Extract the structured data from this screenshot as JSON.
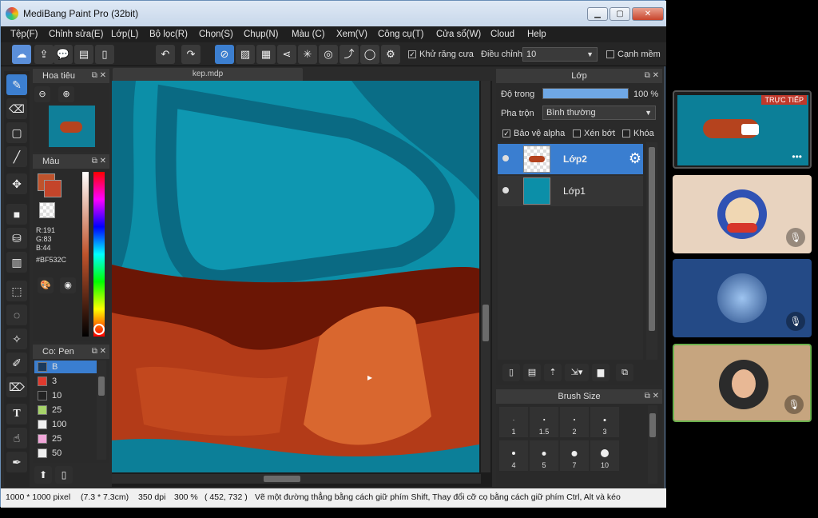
{
  "window": {
    "title": "MediBang Paint Pro (32bit)"
  },
  "menu": [
    "Tệp(F)",
    "Chỉnh sửa(E)",
    "Lớp(L)",
    "Bộ lọc(R)",
    "Chọn(S)",
    "Chụp(N)",
    "Màu (C)",
    "Xem(V)",
    "Công cụ(T)",
    "Cửa sổ(W)",
    "Cloud",
    "Help"
  ],
  "toolbar": {
    "antialias_label": "Khử răng cưa",
    "adjust_label": "Điều chỉnh",
    "adjust_value": "10",
    "edge_label": "Cạnh mềm"
  },
  "navigator": {
    "title": "Hoa tiêu"
  },
  "color_panel": {
    "title": "Màu",
    "r": "R:191",
    "g": "G:83",
    "b": "B:44",
    "hex": "#BF532C",
    "main_color": "#BF532C"
  },
  "pen_panel": {
    "title": "Co: Pen",
    "rows": [
      {
        "size": "B",
        "color": "#1b3a5c"
      },
      {
        "size": "3",
        "color": "#e03a2e"
      },
      {
        "size": "10",
        "color": "#222222"
      },
      {
        "size": "25",
        "color": "#a6d36a"
      },
      {
        "size": "100",
        "color": "#f0f0f0"
      },
      {
        "size": "25",
        "color": "#f0a6d8"
      },
      {
        "size": "50",
        "color": "#f0f0f0"
      }
    ]
  },
  "canvas": {
    "tab": "kep.mdp"
  },
  "layers": {
    "title": "Lớp",
    "opacity_label": "Độ trong",
    "opacity_value": "100 %",
    "blend_label": "Pha trộn",
    "blend_value": "Bình thường",
    "protect_alpha": "Bảo vệ alpha",
    "clip": "Xén bớt",
    "lock": "Khóa",
    "items": [
      {
        "name": "Lớp2",
        "selected": true
      },
      {
        "name": "Lớp1",
        "selected": false
      }
    ]
  },
  "brush_size": {
    "title": "Brush Size",
    "sizes": [
      "1",
      "1.5",
      "2",
      "3",
      "4",
      "5",
      "7",
      "10"
    ]
  },
  "status": {
    "dimensions": "1000 * 1000 pixel",
    "physical": "(7.3 * 7.3cm)",
    "dpi": "350 dpi",
    "zoom": "300 %",
    "coords": "( 452, 732 )",
    "hint": "Vẽ một đường thẳng bằng cách giữ phím Shift, Thay đổi cỡ cọ bằng cách giữ phím Ctrl, Alt và kéo"
  },
  "video_call": {
    "live_label": "TRỰC TIẾP",
    "tiles": [
      {
        "bg": "#e8d3bf",
        "kind": "bear"
      },
      {
        "bg": "#244a86",
        "kind": "city"
      },
      {
        "bg": "#c6a57f",
        "kind": "person"
      }
    ]
  }
}
